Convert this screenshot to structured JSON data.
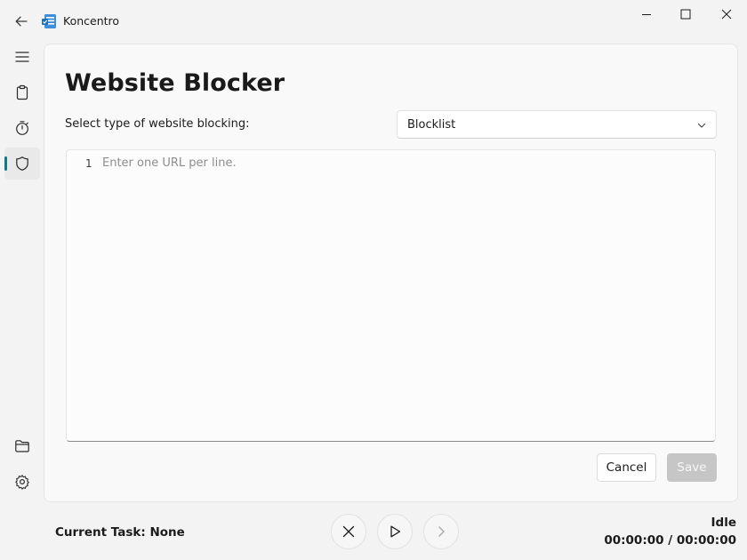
{
  "app": {
    "title": "Koncentro"
  },
  "nav": {
    "items": [
      {
        "name": "menu",
        "icon": "hamburger-menu-icon"
      },
      {
        "name": "tasks",
        "icon": "clipboard-icon"
      },
      {
        "name": "timer",
        "icon": "stopwatch-icon"
      },
      {
        "name": "website-blocker",
        "icon": "shield-icon",
        "active": true
      },
      {
        "name": "workspaces",
        "icon": "folder-icon"
      },
      {
        "name": "settings",
        "icon": "gear-icon"
      }
    ],
    "accent_color": "#0f7a87"
  },
  "page": {
    "title": "Website Blocker",
    "select_label": "Select type of website blocking:",
    "blocking_type": "Blocklist",
    "editor": {
      "line_number": "1",
      "placeholder": "Enter one URL per line."
    },
    "cancel_label": "Cancel",
    "save_label": "Save"
  },
  "bottom": {
    "current_task": "Current Task: None",
    "status": "Idle",
    "time": "00:00:00 / 00:00:00"
  }
}
